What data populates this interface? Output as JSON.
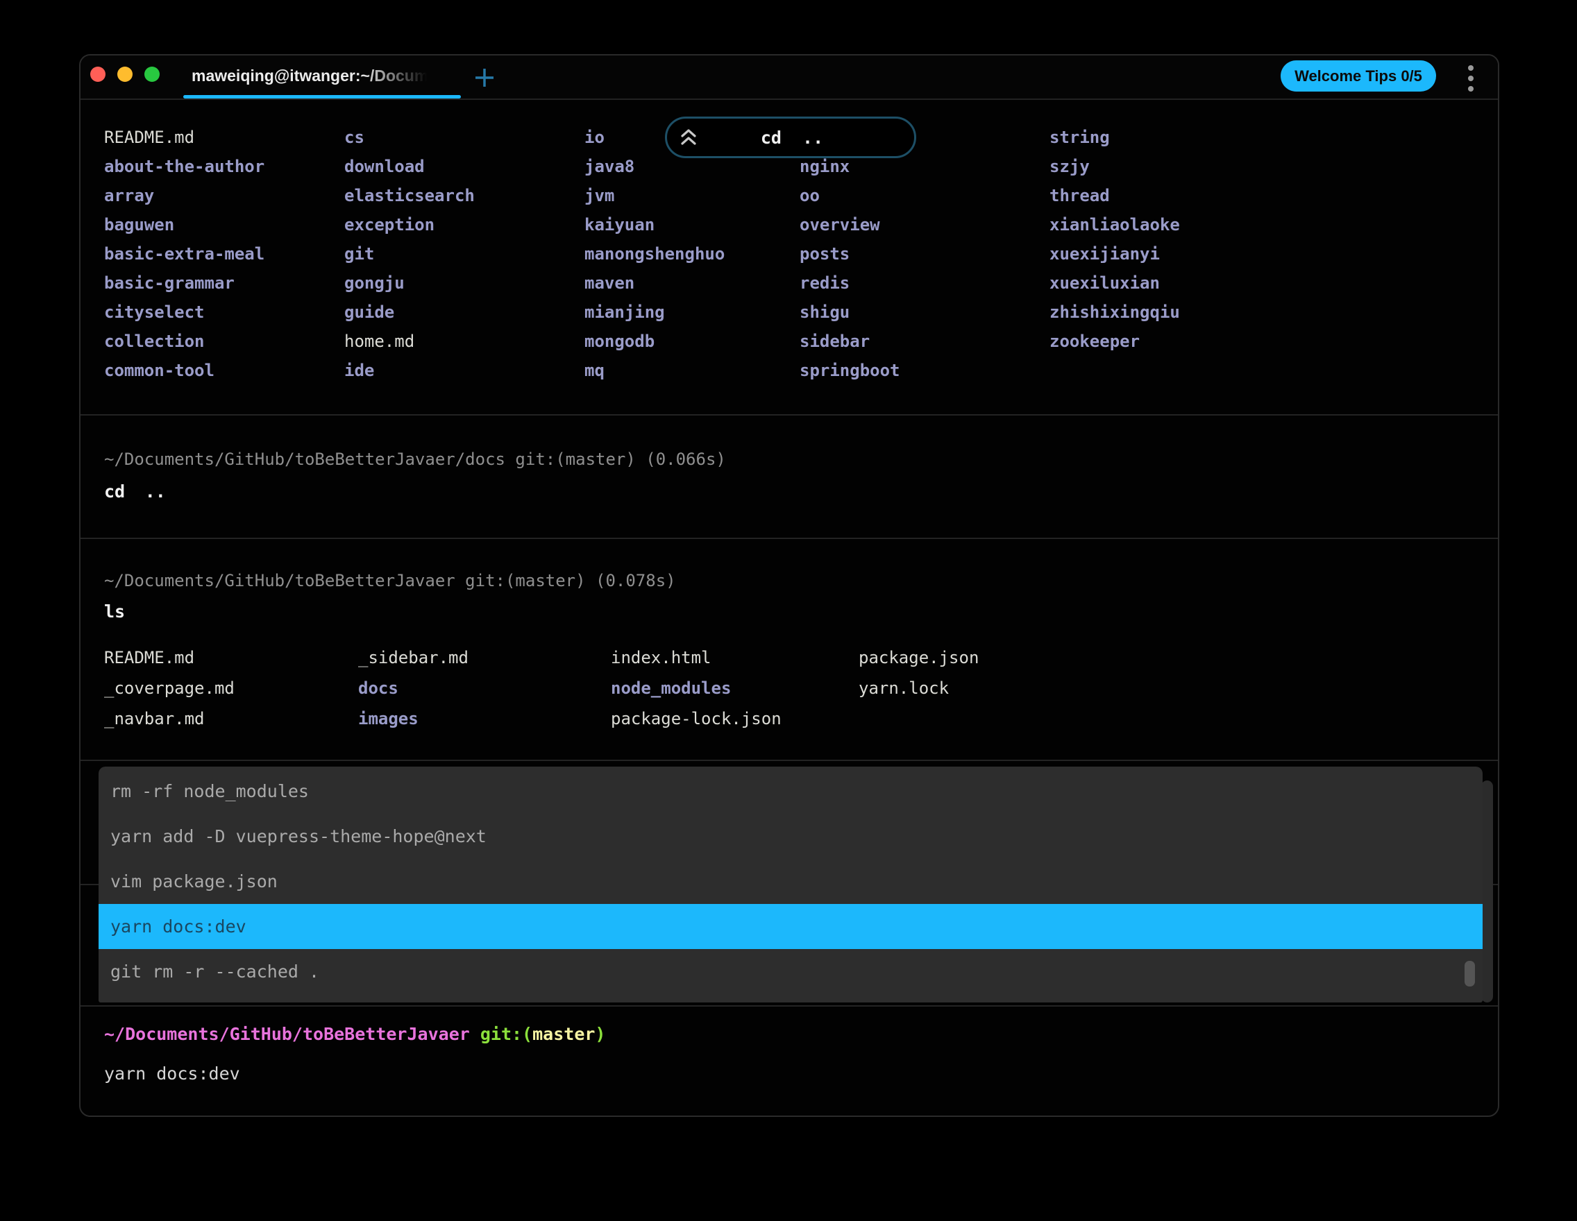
{
  "window": {
    "tab_title": "maweiqing@itwanger:~/Docum",
    "welcome_tips_label": "Welcome Tips 0/5",
    "traffic_lights": [
      "close",
      "minimize",
      "zoom"
    ],
    "icons": {
      "new_tab": "plus-icon",
      "overflow_menu": "kebab-menu-icon",
      "scroll_to_command": "chevrons-up-icon"
    }
  },
  "colors": {
    "accent_blue": "#1cb8fc",
    "directory": "#9a9cc9",
    "file": "#dcdcd6",
    "context_gray": "#8f8f8f",
    "prompt_pink": "#e873dc",
    "prompt_green": "#8ce03c",
    "prompt_branch_yellow": "#f5f3a2",
    "menu_bg": "#2d2d2d",
    "selected_text": "#1a4760",
    "traffic_red": "#ff5f57",
    "traffic_yellow": "#febc2e",
    "traffic_green": "#28c840"
  },
  "blocks": {
    "listing1": {
      "scroll_pill": {
        "command": "cd .."
      },
      "columns": {
        "c1": [
          {
            "text": "README.md",
            "kind": "file"
          },
          {
            "text": "about-the-author",
            "kind": "dir"
          },
          {
            "text": "array",
            "kind": "dir"
          },
          {
            "text": "baguwen",
            "kind": "dir"
          },
          {
            "text": "basic-extra-meal",
            "kind": "dir"
          },
          {
            "text": "basic-grammar",
            "kind": "dir"
          },
          {
            "text": "cityselect",
            "kind": "dir"
          },
          {
            "text": "collection",
            "kind": "dir"
          },
          {
            "text": "common-tool",
            "kind": "dir"
          }
        ],
        "c2": [
          {
            "text": "cs",
            "kind": "dir"
          },
          {
            "text": "download",
            "kind": "dir"
          },
          {
            "text": "elasticsearch",
            "kind": "dir"
          },
          {
            "text": "exception",
            "kind": "dir"
          },
          {
            "text": "git",
            "kind": "dir"
          },
          {
            "text": "gongju",
            "kind": "dir"
          },
          {
            "text": "guide",
            "kind": "dir"
          },
          {
            "text": "home.md",
            "kind": "file"
          },
          {
            "text": "ide",
            "kind": "dir"
          }
        ],
        "c3": [
          {
            "text": "io",
            "kind": "dir"
          },
          {
            "text": "java8",
            "kind": "dir"
          },
          {
            "text": "jvm",
            "kind": "dir"
          },
          {
            "text": "kaiyuan",
            "kind": "dir"
          },
          {
            "text": "manongshenghuo",
            "kind": "dir"
          },
          {
            "text": "maven",
            "kind": "dir"
          },
          {
            "text": "mianjing",
            "kind": "dir"
          },
          {
            "text": "mongodb",
            "kind": "dir"
          },
          {
            "text": "mq",
            "kind": "dir"
          }
        ],
        "c4": [
          {
            "text": "nginx",
            "kind": "dir"
          },
          {
            "text": "oo",
            "kind": "dir"
          },
          {
            "text": "overview",
            "kind": "dir"
          },
          {
            "text": "posts",
            "kind": "dir"
          },
          {
            "text": "redis",
            "kind": "dir"
          },
          {
            "text": "shigu",
            "kind": "dir"
          },
          {
            "text": "sidebar",
            "kind": "dir"
          },
          {
            "text": "springboot",
            "kind": "dir"
          }
        ],
        "c5": [
          {
            "text": "string",
            "kind": "dir"
          },
          {
            "text": "szjy",
            "kind": "dir"
          },
          {
            "text": "thread",
            "kind": "dir"
          },
          {
            "text": "xianliaolaoke",
            "kind": "dir"
          },
          {
            "text": "xuexijianyi",
            "kind": "dir"
          },
          {
            "text": "xuexiluxian",
            "kind": "dir"
          },
          {
            "text": "zhishixingqiu",
            "kind": "dir"
          },
          {
            "text": "zookeeper",
            "kind": "dir"
          }
        ]
      }
    },
    "block_cd": {
      "context": "~/Documents/GitHub/toBeBetterJavaer/docs git:(master) (0.066s)",
      "command": "cd .."
    },
    "block_ls": {
      "context": "~/Documents/GitHub/toBeBetterJavaer git:(master) (0.078s)",
      "command": "ls",
      "columns": {
        "c1": [
          {
            "text": "README.md",
            "kind": "file"
          },
          {
            "text": "_coverpage.md",
            "kind": "file"
          },
          {
            "text": "_navbar.md",
            "kind": "file"
          }
        ],
        "c2": [
          {
            "text": "_sidebar.md",
            "kind": "file"
          },
          {
            "text": "docs",
            "kind": "dir"
          },
          {
            "text": "images",
            "kind": "dir"
          }
        ],
        "c3": [
          {
            "text": "index.html",
            "kind": "file"
          },
          {
            "text": "node_modules",
            "kind": "dir"
          },
          {
            "text": "package-lock.json",
            "kind": "file"
          }
        ],
        "c4": [
          {
            "text": "package.json",
            "kind": "file"
          },
          {
            "text": "yarn.lock",
            "kind": "file"
          }
        ]
      }
    },
    "history_menu": {
      "items": [
        {
          "text": "rm -rf node_modules"
        },
        {
          "text": "yarn add -D vuepress-theme-hope@next"
        },
        {
          "text": "vim package.json"
        },
        {
          "text": "yarn docs:dev",
          "state": "selected"
        },
        {
          "text": "git rm -r --cached ."
        }
      ]
    },
    "prompt_block": {
      "path": "~/Documents/GitHub/toBeBetterJavaer",
      "git_prefix": " git:(",
      "branch": "master",
      "git_suffix": ")",
      "input": "yarn docs:dev"
    }
  }
}
